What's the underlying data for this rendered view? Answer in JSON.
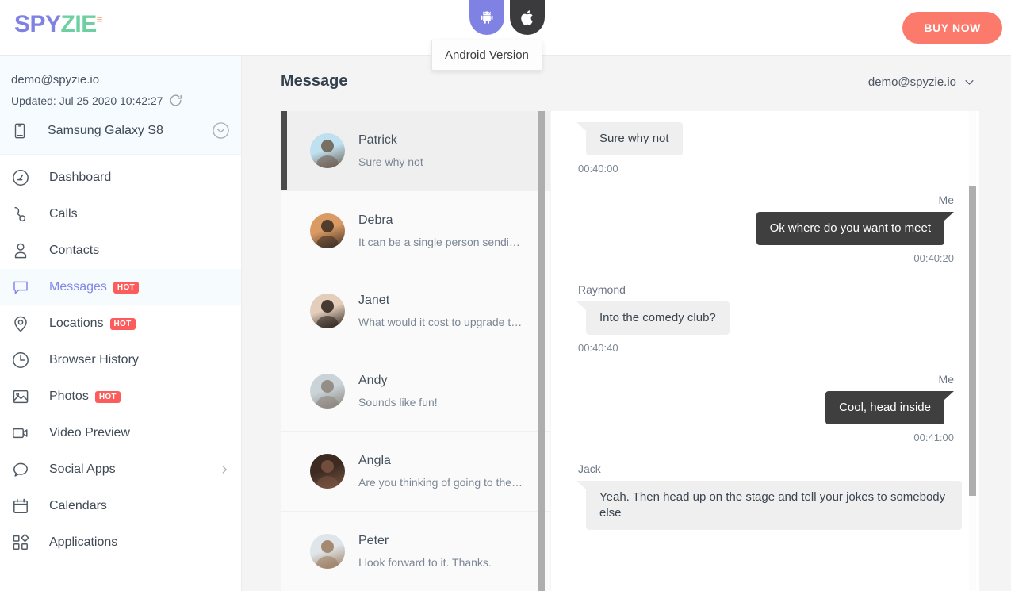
{
  "topbar": {
    "logo": {
      "part1": "SPY",
      "part2": "ZIE",
      "tm": "≡"
    },
    "os_buttons": [
      {
        "name": "android-version-button",
        "icon": "android-icon",
        "color": "#7f82e3"
      },
      {
        "name": "apple-version-button",
        "icon": "apple-icon",
        "color": "#3b3b3d"
      }
    ],
    "tooltip": "Android Version",
    "buy_now_label": "BUY NOW",
    "buy_now_color": "#fb7a6c"
  },
  "sidebar": {
    "account_email": "demo@spyzie.io",
    "updated_label": "Updated: Jul 25 2020 10:42:27",
    "device_name": "Samsung Galaxy S8",
    "items": [
      {
        "label": "Dashboard",
        "icon": "dashboard-icon",
        "badge": "",
        "arrow": false,
        "active": false
      },
      {
        "label": "Calls",
        "icon": "phone-icon",
        "badge": "",
        "arrow": false,
        "active": false
      },
      {
        "label": "Contacts",
        "icon": "person-icon",
        "badge": "",
        "arrow": false,
        "active": false
      },
      {
        "label": "Messages",
        "icon": "chat-bubble-icon",
        "badge": "HOT",
        "arrow": false,
        "active": true
      },
      {
        "label": "Locations",
        "icon": "map-pin-icon",
        "badge": "HOT",
        "arrow": false,
        "active": false
      },
      {
        "label": "Browser History",
        "icon": "clock-icon",
        "badge": "",
        "arrow": false,
        "active": false
      },
      {
        "label": "Photos",
        "icon": "image-icon",
        "badge": "HOT",
        "arrow": false,
        "active": false
      },
      {
        "label": "Video Preview",
        "icon": "video-camera-icon",
        "badge": "",
        "arrow": false,
        "active": false
      },
      {
        "label": "Social Apps",
        "icon": "speech-bubble-icon",
        "badge": "",
        "arrow": true,
        "active": false
      },
      {
        "label": "Calendars",
        "icon": "calendar-icon",
        "badge": "",
        "arrow": false,
        "active": false
      },
      {
        "label": "Applications",
        "icon": "apps-grid-icon",
        "badge": "",
        "arrow": false,
        "active": false
      }
    ],
    "badge_color": "#fc5c5c",
    "active_color": "#8287e8"
  },
  "main": {
    "page_title": "Message",
    "user_menu_label": "demo@spyzie.io"
  },
  "contacts": [
    {
      "name": "Patrick",
      "snippet": "Sure why not",
      "selected": true,
      "avatar_colors": [
        "#bfe0ef",
        "#6b5a4c"
      ]
    },
    {
      "name": "Debra",
      "snippet": "It can be a single person sendi…",
      "selected": false,
      "avatar_colors": [
        "#d99a63",
        "#3a2b22"
      ]
    },
    {
      "name": "Janet",
      "snippet": "What would it cost to upgrade t…",
      "selected": false,
      "avatar_colors": [
        "#e3cdbb",
        "#2a2019"
      ]
    },
    {
      "name": "Andy",
      "snippet": "Sounds like fun!",
      "selected": false,
      "avatar_colors": [
        "#c9d3d8",
        "#8a8178"
      ]
    },
    {
      "name": "Angla",
      "snippet": "Are you thinking of going to the…",
      "selected": false,
      "avatar_colors": [
        "#3d2b22",
        "#7a5442"
      ]
    },
    {
      "name": "Peter",
      "snippet": "I look forward to it. Thanks.",
      "selected": false,
      "avatar_colors": [
        "#dfe5e8",
        "#9b7a5e"
      ]
    }
  ],
  "messages": [
    {
      "sender": "",
      "side": "them",
      "text": "Sure why not",
      "time": "00:40:00"
    },
    {
      "sender": "Me",
      "side": "me",
      "text": "Ok where do you want to meet",
      "time": "00:40:20"
    },
    {
      "sender": "Raymond",
      "side": "them",
      "text": "Into the comedy club?",
      "time": "00:40:40"
    },
    {
      "sender": "Me",
      "side": "me",
      "text": "Cool, head inside",
      "time": "00:41:00"
    },
    {
      "sender": "Jack",
      "side": "them",
      "text": "Yeah. Then head up on the stage and tell your jokes to somebody else",
      "time": ""
    }
  ]
}
